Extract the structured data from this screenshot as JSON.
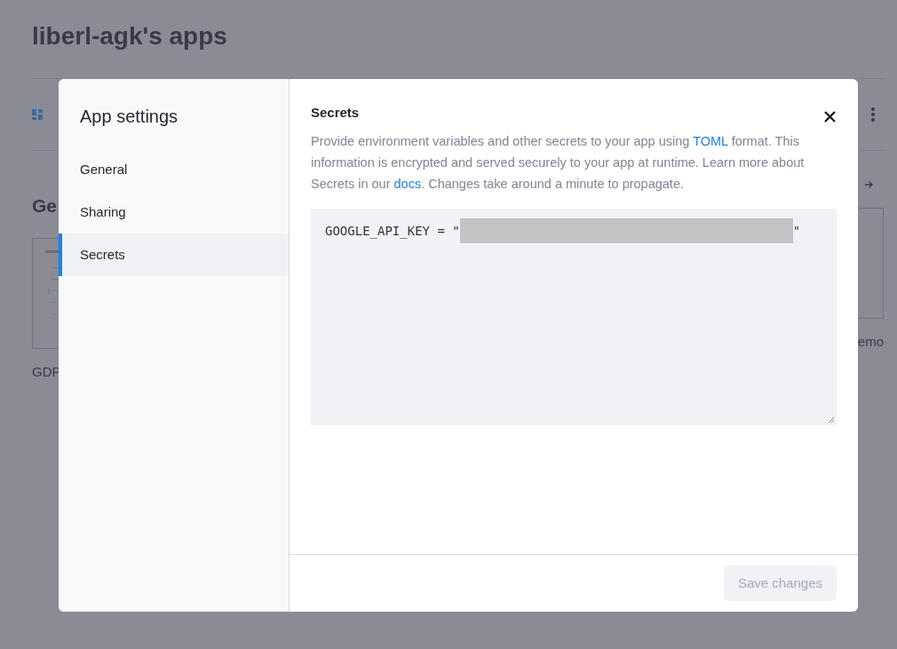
{
  "page": {
    "title": "liberl-agk's apps",
    "section_heading": "Ge",
    "cards": [
      {
        "caption": "GDP"
      },
      {
        "caption": "emo"
      }
    ]
  },
  "modal": {
    "title": "App settings",
    "nav": [
      {
        "label": "General",
        "selected": false
      },
      {
        "label": "Sharing",
        "selected": false
      },
      {
        "label": "Secrets",
        "selected": true
      }
    ],
    "section_title": "Secrets",
    "description": [
      {
        "kind": "text",
        "text": "Provide environment variables and other secrets to your app using "
      },
      {
        "kind": "link",
        "text": "TOML"
      },
      {
        "kind": "text",
        "text": " format. This information is encrypted and served securely to your app at runtime. Learn more about Secrets in our "
      },
      {
        "kind": "link",
        "text": "docs"
      },
      {
        "kind": "text",
        "text": ". Changes take around a minute to propagate."
      }
    ],
    "editor": {
      "prefix": "GOOGLE_API_KEY = \"",
      "redacted": true,
      "suffix": "\""
    },
    "save_button": {
      "label": "Save changes",
      "disabled": true
    }
  }
}
